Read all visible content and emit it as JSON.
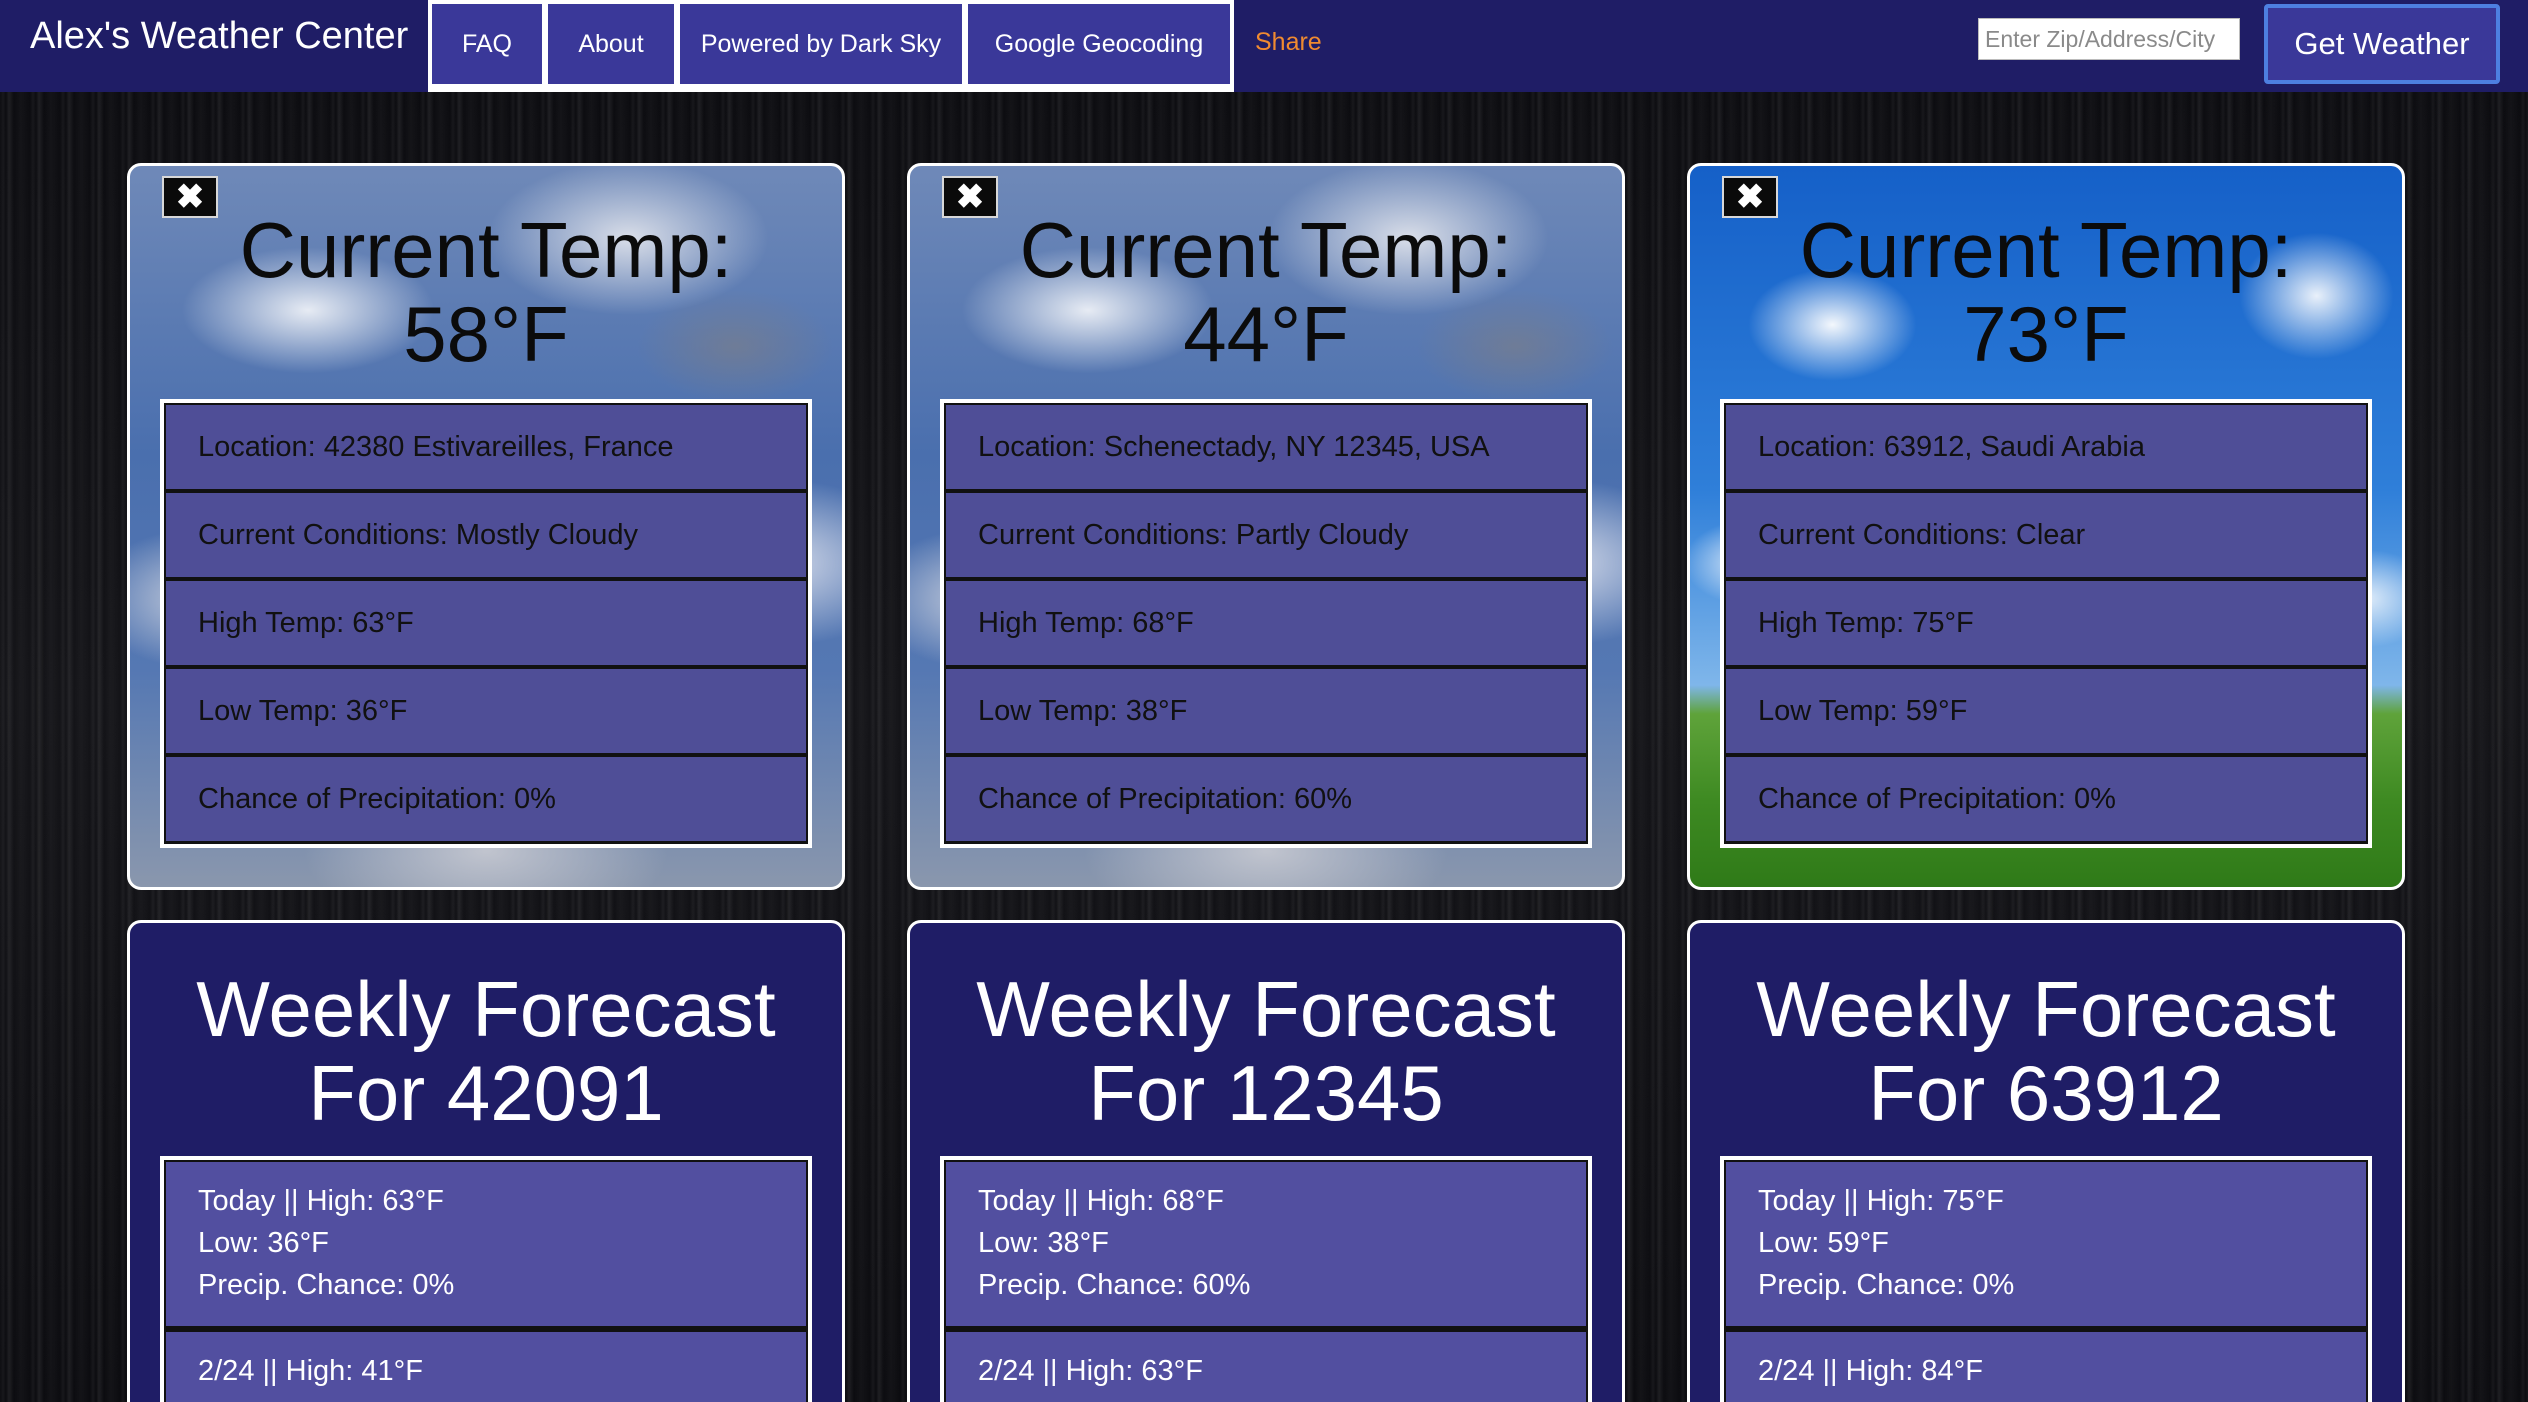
{
  "nav": {
    "brand": "Alex's Weather Center",
    "links": [
      "FAQ",
      "About",
      "Powered by Dark Sky",
      "Google Geocoding"
    ],
    "share": "Share",
    "search_placeholder": "Enter Zip/Address/City",
    "get_weather": "Get Weather"
  },
  "close_glyph": "✖",
  "cards": [
    {
      "sky": "cloudy",
      "title": "Current Temp:",
      "temp": "58°F",
      "location": "Location: 42380 Estivareilles, France",
      "conditions": "Current Conditions: Mostly Cloudy",
      "high": "High Temp: 63°F",
      "low": "Low Temp: 36°F",
      "precip": "Chance of Precipitation: 0%",
      "weekly_title": "Weekly Forecast For 42091",
      "today": [
        "Today || High: 63°F",
        "Low: 36°F",
        "Precip. Chance: 0%"
      ],
      "next": "2/24 || High: 41°F"
    },
    {
      "sky": "cloudy",
      "title": "Current Temp:",
      "temp": "44°F",
      "location": "Location: Schenectady, NY 12345, USA",
      "conditions": "Current Conditions: Partly Cloudy",
      "high": "High Temp: 68°F",
      "low": "Low Temp: 38°F",
      "precip": "Chance of Precipitation: 60%",
      "weekly_title": "Weekly Forecast For 12345",
      "today": [
        "Today || High: 68°F",
        "Low: 38°F",
        "Precip. Chance: 60%"
      ],
      "next": "2/24 || High: 63°F"
    },
    {
      "sky": "clear",
      "title": "Current Temp:",
      "temp": "73°F",
      "location": "Location: 63912, Saudi Arabia",
      "conditions": "Current Conditions: Clear",
      "high": "High Temp: 75°F",
      "low": "Low Temp: 59°F",
      "precip": "Chance of Precipitation: 0%",
      "weekly_title": "Weekly Forecast For 63912",
      "today": [
        "Today || High: 75°F",
        "Low: 59°F",
        "Precip. Chance: 0%"
      ],
      "next": "2/24 || High: 84°F"
    }
  ]
}
